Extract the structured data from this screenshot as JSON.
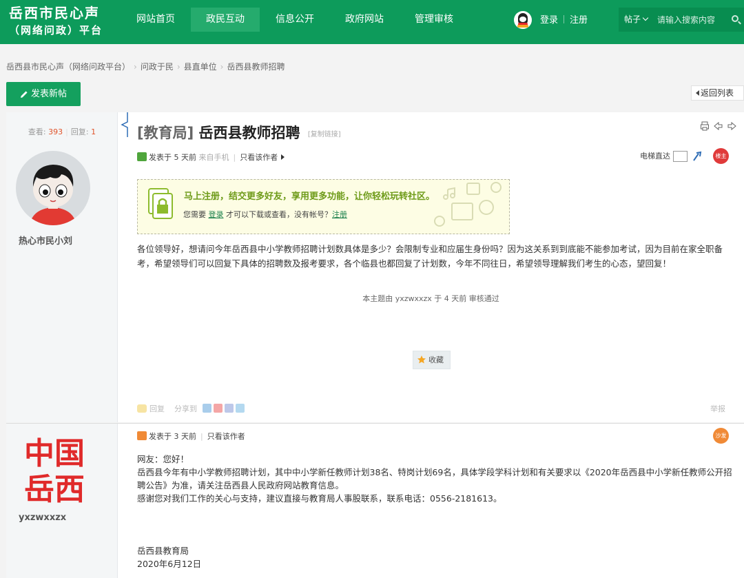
{
  "header": {
    "logo_line1": "岳西市民心声",
    "logo_line2": "（网络问政）平台",
    "nav": [
      "网站首页",
      "政民互动",
      "信息公开",
      "政府网站",
      "管理审核"
    ],
    "active_nav": "政民互动",
    "login_label": "登录",
    "register_label": "注册",
    "search_category": "帖子",
    "search_placeholder": "请输入搜索内容"
  },
  "breadcrumb": [
    "岳西县市民心声（网络问政平台）",
    "问政于民",
    "县直单位",
    "岳西县教师招聘"
  ],
  "actions": {
    "new_post_label": "发表新帖",
    "back_to_list_label": "返回列表"
  },
  "thread": {
    "views_label": "查看:",
    "views": "393",
    "replies_label": "回复:",
    "replies": "1",
    "category_tag": "[教育局]",
    "title": "岳西县教师招聘",
    "copy_link_label": "[复制链接]"
  },
  "post1": {
    "author": "热心市民小刘",
    "posted_label": "发表于 5 天前",
    "source": "来自手机",
    "only_author_label": "只看该作者",
    "elevator_label": "电梯直达",
    "floor_badge": "楼主",
    "notice_heading": "马上注册，结交更多好友，享用更多功能，让你轻松玩转社区。",
    "notice_text_before": "您需要",
    "notice_login_link": "登录",
    "notice_text_middle": "才可以下载或查看，没有帐号？",
    "notice_register_link": "注册",
    "body": "各位领导好，想请问今年岳西县中小学教师招聘计划数具体是多少？会限制专业和应届生身份吗？因为这关系到到底能不能参加考试，因为目前在家全职备考，希望领导们可以回复下具体的招聘数及报考要求，各个临县也都回复了计划数，今年不同往日，希望领导理解我们考生的心态，望回复！",
    "review_note": "本主题由 yxzwxxzx 于 4 天前 审核通过",
    "favorite_label": "收藏",
    "reply_label": "回复",
    "share_label": "分享到",
    "report_label": "举报"
  },
  "post2": {
    "author": "yxzwxxzx",
    "logo_text_top": "中国",
    "logo_text_bottom": "岳西",
    "posted_label": "发表于 3 天前",
    "only_author_label": "只看该作者",
    "floor_badge": "沙发",
    "line1": "网友：您好！",
    "line2": "岳西县今年有中小学教师招聘计划，其中中小学新任教师计划38名、特岗计划69名，具体学段学科计划和有关要求以《2020年岳西县中小学新任教师公开招聘公告》为准，请关注岳西县人民政府网站教育信息。",
    "line3": "感谢您对我们工作的关心与支持，建议直接与教育局人事股联系，联系电话：0556-2181613。",
    "sign_org": "岳西县教育局",
    "sign_date": "2020年6月12日"
  },
  "colors": {
    "brand_green": "#0d9b5b",
    "active_nav": "#25ab6d",
    "stat_number": "#e0532a",
    "logo_red": "#e02a2a",
    "floor_badge_red": "#e03a3a",
    "floor_badge_orange": "#f08a36"
  }
}
